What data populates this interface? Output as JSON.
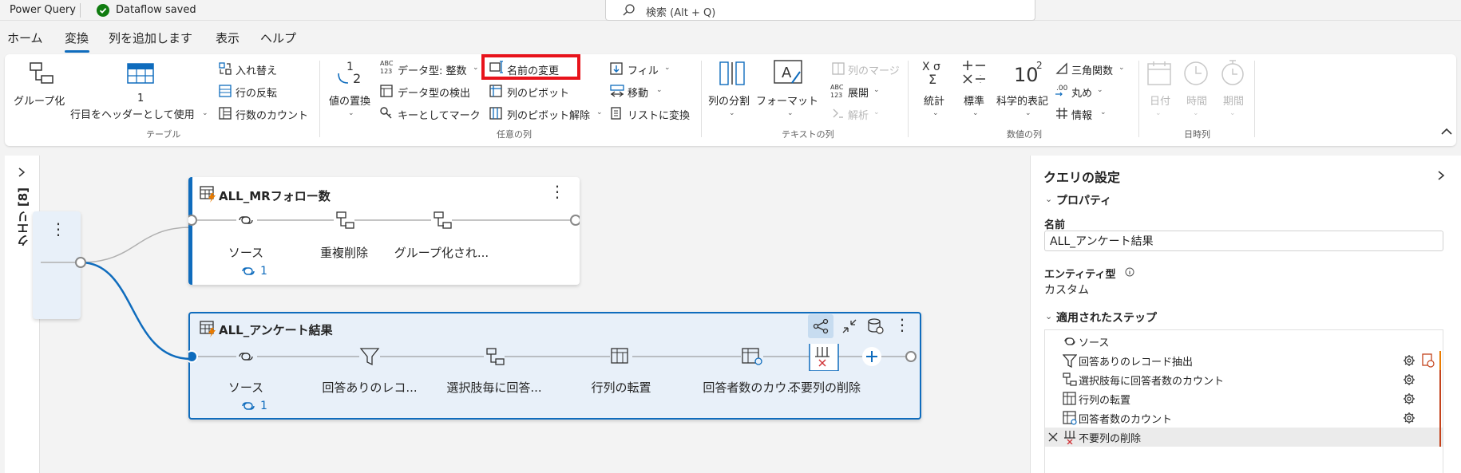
{
  "titlebar": {
    "app": "Power Query",
    "saved": "Dataflow saved",
    "search_placeholder": "検索 (Alt + Q)"
  },
  "tabs": [
    {
      "label": "ホーム"
    },
    {
      "label": "変換",
      "active": true
    },
    {
      "label": "列を追加します"
    },
    {
      "label": "表示"
    },
    {
      "label": "ヘルプ"
    }
  ],
  "ribbon": {
    "table": {
      "group": "テーブル",
      "group_by": "グループ化",
      "use_header_top": "1",
      "use_header": "行目をヘッダーとして使用",
      "swap": "入れ替え",
      "reverse_rows": "行の反転",
      "count_rows": "行数のカウント"
    },
    "any_column": {
      "group": "任意の列",
      "replace_values": "値の置換",
      "data_type": "データ型: 整数",
      "detect_type": "データ型の検出",
      "mark_key": "キーとしてマーク",
      "rename": "名前の変更",
      "pivot": "列のピボット",
      "unpivot": "列のピボット解除",
      "fill": "フィル",
      "move": "移動",
      "to_list": "リストに変換"
    },
    "text_column": {
      "group": "テキストの列",
      "split": "列の分割",
      "format": "フォーマット",
      "merge": "列のマージ",
      "expand": "展開",
      "parse": "解析"
    },
    "number_column": {
      "group": "数値の列",
      "statistics": "統計",
      "standard": "標準",
      "scientific": "科学的表記",
      "trig": "三角関数",
      "rounding": "丸め",
      "info": "情報"
    },
    "datetime_column": {
      "group": "日時列",
      "date": "日付",
      "time": "時間",
      "duration": "期間"
    }
  },
  "query_pane": {
    "label": "クエリ [8]"
  },
  "canvas": {
    "card1": {
      "title": "ALL_MRフォロー数",
      "steps": [
        "ソース",
        "重複削除",
        "グループ化され..."
      ],
      "link_count": "1"
    },
    "card2": {
      "title": "ALL_アンケート結果",
      "steps": [
        "ソース",
        "回答ありのレコ...",
        "選択肢毎に回答...",
        "行列の転置",
        "回答者数のカウ...",
        "不要列の削除"
      ],
      "link_count": "1"
    }
  },
  "settings": {
    "title": "クエリの設定",
    "properties": "プロパティ",
    "name_label": "名前",
    "name_value": "ALL_アンケート結果",
    "entity_label": "エンティティ型",
    "entity_value": "カスタム",
    "applied_steps": "適用されたステップ",
    "steps": [
      {
        "label": "ソース"
      },
      {
        "label": "回答ありのレコード抽出"
      },
      {
        "label": "選択肢毎に回答者数のカウント"
      },
      {
        "label": "行列の転置"
      },
      {
        "label": "回答者数のカウント"
      },
      {
        "label": "不要列の削除",
        "selected": true
      }
    ]
  },
  "colors": {
    "accent": "#0f6cbd",
    "highlight": "#e8131b",
    "saved": "#107c10"
  }
}
